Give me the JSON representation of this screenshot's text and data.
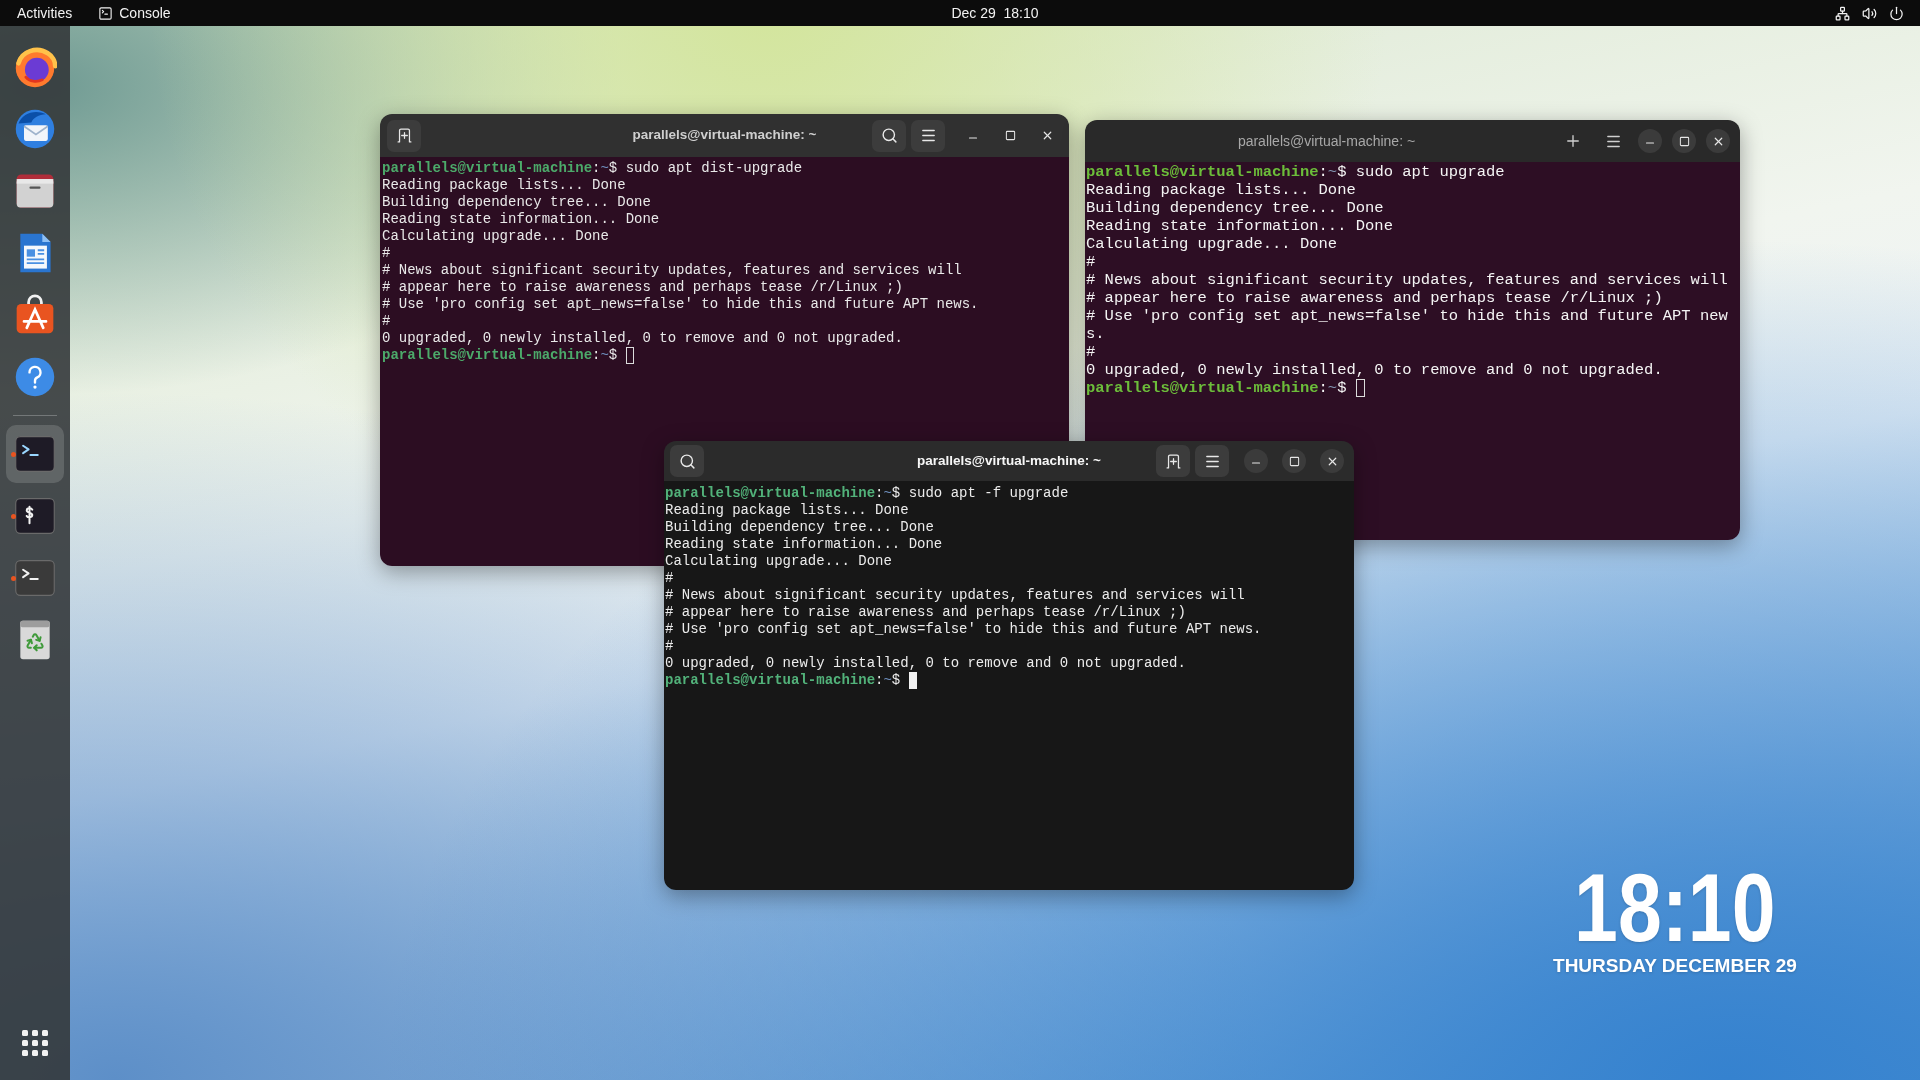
{
  "top_bar": {
    "activities": "Activities",
    "app_menu": "Console",
    "clock": "Dec 29  18:10"
  },
  "dock": {
    "groups": [
      {
        "items": [
          {
            "running": false,
            "selected": false
          },
          {
            "running": false,
            "selected": false
          },
          {
            "running": false,
            "selected": false
          },
          {
            "running": false,
            "selected": false
          },
          {
            "running": false,
            "selected": false
          },
          {
            "running": false,
            "selected": false
          }
        ]
      },
      {
        "items": [
          {
            "running": true,
            "selected": true
          },
          {
            "running": true,
            "selected": false
          },
          {
            "running": true,
            "selected": false
          },
          {
            "running": false,
            "selected": false
          }
        ]
      }
    ]
  },
  "windows": [
    {
      "kind": "classic",
      "title": "parallels@virtual-machine: ~",
      "focused": false,
      "lines": [
        {
          "kind": "prompt",
          "cursor": false,
          "parts": [
            {
              "kind": "user",
              "text": "parallels@virtual-machine"
            },
            {
              "kind": "plain",
              "text": ":"
            },
            {
              "kind": "path",
              "text": "~"
            },
            {
              "kind": "plain",
              "text": "$ sudo apt dist-upgrade"
            }
          ]
        },
        {
          "kind": "output",
          "text": "Reading package lists... Done"
        },
        {
          "kind": "output",
          "text": "Building dependency tree... Done"
        },
        {
          "kind": "output",
          "text": "Reading state information... Done"
        },
        {
          "kind": "output",
          "text": "Calculating upgrade... Done"
        },
        {
          "kind": "output",
          "text": "#"
        },
        {
          "kind": "output",
          "text": "# News about significant security updates, features and services will"
        },
        {
          "kind": "output",
          "text": "# appear here to raise awareness and perhaps tease /r/Linux ;)"
        },
        {
          "kind": "output",
          "text": "# Use 'pro config set apt_news=false' to hide this and future APT news."
        },
        {
          "kind": "output",
          "text": "#"
        },
        {
          "kind": "output",
          "text": "0 upgraded, 0 newly installed, 0 to remove and 0 not upgraded."
        },
        {
          "kind": "prompt",
          "cursor": true,
          "parts": [
            {
              "kind": "user",
              "text": "parallels@virtual-machine"
            },
            {
              "kind": "plain",
              "text": ":"
            },
            {
              "kind": "path",
              "text": "~"
            },
            {
              "kind": "plain",
              "text": "$"
            }
          ]
        }
      ]
    },
    {
      "kind": "console",
      "title": "parallels@virtual-machine: ~",
      "focused": false,
      "lines": [
        {
          "kind": "prompt",
          "cursor": false,
          "parts": [
            {
              "kind": "user",
              "text": "parallels@virtual-machine"
            },
            {
              "kind": "plain",
              "text": ":"
            },
            {
              "kind": "path",
              "text": "~"
            },
            {
              "kind": "plain",
              "text": "$ sudo apt upgrade"
            }
          ]
        },
        {
          "kind": "output",
          "text": "Reading package lists... Done"
        },
        {
          "kind": "output",
          "text": "Building dependency tree... Done"
        },
        {
          "kind": "output",
          "text": "Reading state information... Done"
        },
        {
          "kind": "output",
          "text": "Calculating upgrade... Done"
        },
        {
          "kind": "output",
          "text": "#"
        },
        {
          "kind": "output",
          "text": "# News about significant security updates, features and services will"
        },
        {
          "kind": "output",
          "text": "# appear here to raise awareness and perhaps tease /r/Linux ;)"
        },
        {
          "kind": "output",
          "text": "# Use 'pro config set apt_news=false' to hide this and future APT new"
        },
        {
          "kind": "output",
          "text": "s."
        },
        {
          "kind": "output",
          "text": "#"
        },
        {
          "kind": "output",
          "text": "0 upgraded, 0 newly installed, 0 to remove and 0 not upgraded."
        },
        {
          "kind": "prompt",
          "cursor": true,
          "parts": [
            {
              "kind": "user",
              "text": "parallels@virtual-machine"
            },
            {
              "kind": "plain",
              "text": ":"
            },
            {
              "kind": "path",
              "text": "~"
            },
            {
              "kind": "plain",
              "text": "$"
            }
          ]
        }
      ]
    },
    {
      "kind": "modern",
      "title": "parallels@virtual-machine: ~",
      "focused": true,
      "lines": [
        {
          "kind": "prompt",
          "cursor": false,
          "parts": [
            {
              "kind": "user",
              "text": "parallels@virtual-machine"
            },
            {
              "kind": "plain",
              "text": ":"
            },
            {
              "kind": "path",
              "text": "~"
            },
            {
              "kind": "plain",
              "text": "$ sudo apt -f upgrade"
            }
          ]
        },
        {
          "kind": "output",
          "text": "Reading package lists... Done"
        },
        {
          "kind": "output",
          "text": "Building dependency tree... Done"
        },
        {
          "kind": "output",
          "text": "Reading state information... Done"
        },
        {
          "kind": "output",
          "text": "Calculating upgrade... Done"
        },
        {
          "kind": "output",
          "text": "#"
        },
        {
          "kind": "output",
          "text": "# News about significant security updates, features and services will"
        },
        {
          "kind": "output",
          "text": "# appear here to raise awareness and perhaps tease /r/Linux ;)"
        },
        {
          "kind": "output",
          "text": "# Use 'pro config set apt_news=false' to hide this and future APT news."
        },
        {
          "kind": "output",
          "text": "#"
        },
        {
          "kind": "output",
          "text": "0 upgraded, 0 newly installed, 0 to remove and 0 not upgraded."
        },
        {
          "kind": "prompt",
          "cursor": true,
          "parts": [
            {
              "kind": "user",
              "text": "parallels@virtual-machine"
            },
            {
              "kind": "plain",
              "text": ":"
            },
            {
              "kind": "path",
              "text": "~"
            },
            {
              "kind": "plain",
              "text": "$"
            }
          ]
        }
      ]
    }
  ],
  "desktop_clock": {
    "time": "18:10",
    "date": "THURSDAY DECEMBER 29"
  }
}
